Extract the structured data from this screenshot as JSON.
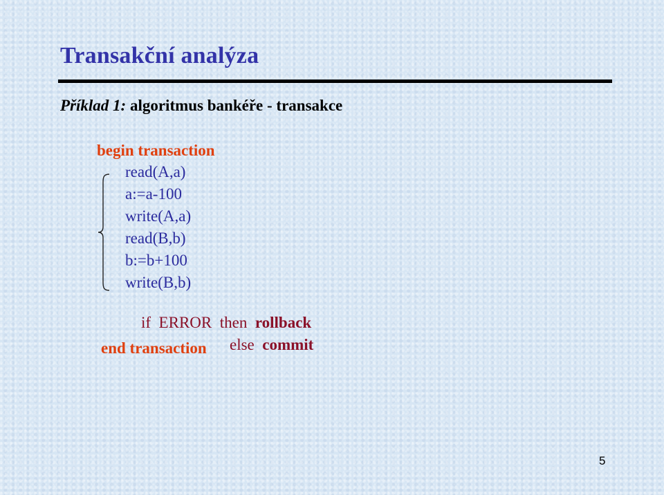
{
  "slide": {
    "title": "Transakční analýza",
    "subtitle": {
      "label_italic": "Příklad 1:",
      "text": " algoritmus bankéře - transakce"
    },
    "code": {
      "begin": "begin transaction",
      "statements": [
        "read(A,a)",
        "a:=a-100",
        "write(A,a)",
        "read(B,b)",
        "b:=b+100",
        "write(B,b)"
      ],
      "if_prefix": "if  ERROR  then  ",
      "if_action": "rollback",
      "else_prefix": "else  ",
      "else_action": "commit",
      "end": "end transaction"
    },
    "page_number": "5"
  },
  "colors": {
    "title": "#3333a8",
    "keyword": "#e0400f",
    "code": "#2b2b9e",
    "condition": "#8a1028",
    "background": "#d7e6f4"
  }
}
